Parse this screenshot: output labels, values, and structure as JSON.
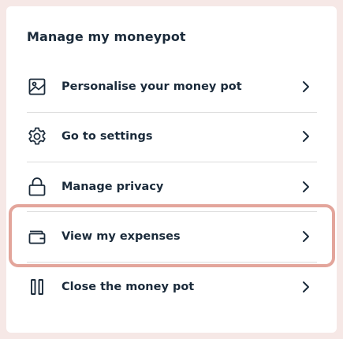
{
  "panel": {
    "title": "Manage my moneypot",
    "items": [
      {
        "label": "Personalise your money pot",
        "icon": "image-icon"
      },
      {
        "label": "Go to settings",
        "icon": "gear-icon"
      },
      {
        "label": "Manage privacy",
        "icon": "lock-icon"
      },
      {
        "label": "View my expenses",
        "icon": "wallet-icon",
        "highlighted": true
      },
      {
        "label": "Close the money pot",
        "icon": "pause-icon"
      }
    ]
  },
  "colors": {
    "background": "#f6e8e6",
    "card": "#ffffff",
    "text": "#1a2a3a",
    "highlight_border": "#e3a59b",
    "divider": "#dcdcdc"
  }
}
